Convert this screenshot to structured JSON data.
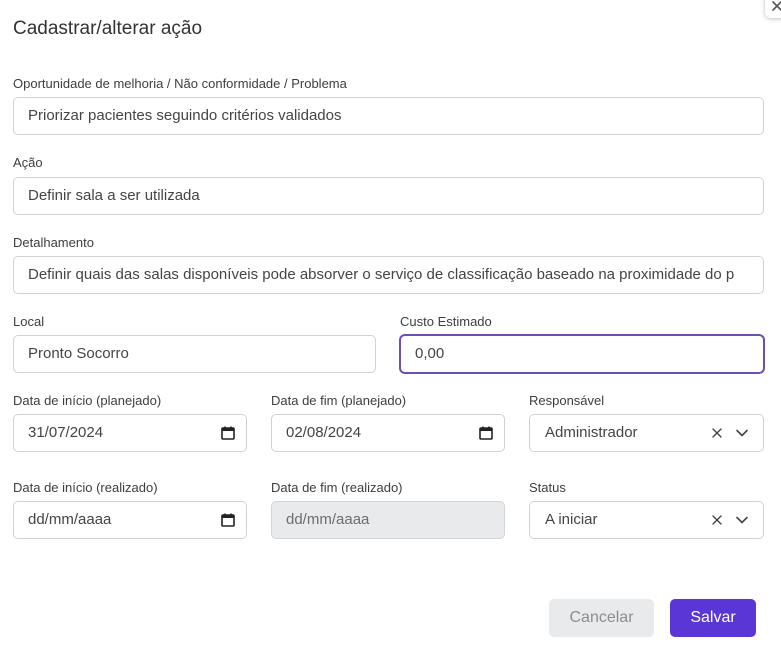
{
  "modal": {
    "title": "Cadastrar/alterar ação",
    "close_icon": "close-icon"
  },
  "form": {
    "oportunidade": {
      "label": "Oportunidade de melhoria / Não conformidade / Problema",
      "value": "Priorizar pacientes seguindo critérios validados"
    },
    "acao": {
      "label": "Ação",
      "value": "Definir sala a ser utilizada"
    },
    "detalhamento": {
      "label": "Detalhamento",
      "value": "Definir quais das salas disponíveis pode absorver o serviço de classificação baseado na proximidade do p"
    },
    "local": {
      "label": "Local",
      "value": "Pronto Socorro"
    },
    "custo": {
      "label": "Custo Estimado",
      "value": "0,00"
    },
    "data_inicio_planejado": {
      "label": "Data de início (planejado)",
      "value": "31/07/2024"
    },
    "data_fim_planejado": {
      "label": "Data de fim (planejado)",
      "value": "02/08/2024"
    },
    "responsavel": {
      "label": "Responsável",
      "value": "Administrador"
    },
    "data_inicio_realizado": {
      "label": "Data de início (realizado)",
      "value": "dd/mm/aaaa"
    },
    "data_fim_realizado": {
      "label": "Data de fim (realizado)",
      "value": "dd/mm/aaaa"
    },
    "status": {
      "label": "Status",
      "value": "A iniciar"
    }
  },
  "actions": {
    "cancel_label": "Cancelar",
    "save_label": "Salvar"
  },
  "colors": {
    "primary": "#5a36d6",
    "focus_border": "#6a4fb8",
    "disabled_bg": "#e9eaec"
  }
}
